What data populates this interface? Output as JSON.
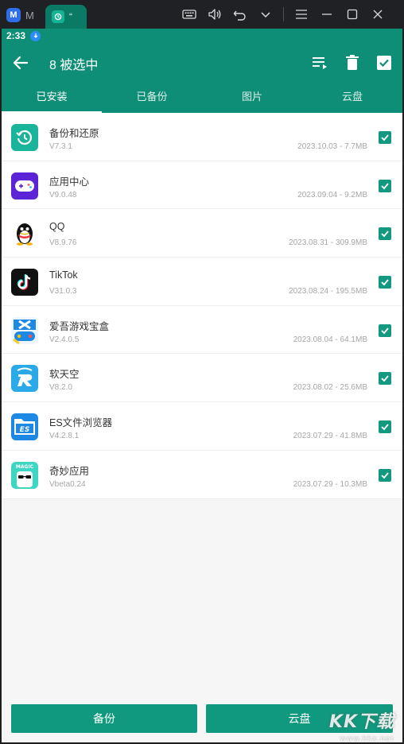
{
  "window": {
    "tab1_label": "M",
    "tab2_label": "“",
    "tools": [
      "keyboard-icon",
      "volume-icon",
      "undo-icon",
      "chevron-down-icon",
      "menu-icon",
      "minimize-icon",
      "maximize-icon",
      "close-icon"
    ]
  },
  "status": {
    "time": "2:33"
  },
  "appbar": {
    "title": "8 被选中"
  },
  "tabs": [
    {
      "label": "已安装",
      "active": true
    },
    {
      "label": "已备份",
      "active": false
    },
    {
      "label": "图片",
      "active": false
    },
    {
      "label": "云盘",
      "active": false
    }
  ],
  "apps": [
    {
      "name": "备份和还原",
      "version": "V7.3.1",
      "meta": "2023.10.03 - 7.7MB",
      "icon": "backup-restore-icon",
      "checked": true
    },
    {
      "name": "应用中心",
      "version": "V9.0.48",
      "meta": "2023.09.04 - 9.2MB",
      "icon": "game-controller-icon",
      "checked": true
    },
    {
      "name": "QQ",
      "version": "V8.9.76",
      "meta": "2023.08.31 - 309.9MB",
      "icon": "qq-penguin-icon",
      "checked": true
    },
    {
      "name": "TikTok",
      "version": "V31.0.3",
      "meta": "2023.08.24 - 195.5MB",
      "icon": "tiktok-icon",
      "checked": true
    },
    {
      "name": "爱吾游戏宝盒",
      "version": "V2.4.0.5",
      "meta": "2023.08.04 - 64.1MB",
      "icon": "aiwu-game-box-icon",
      "checked": true
    },
    {
      "name": "软天空",
      "version": "V8.2.0",
      "meta": "2023.08.02 - 25.6MB",
      "icon": "ruantiankong-icon",
      "checked": true
    },
    {
      "name": "ES文件浏览器",
      "version": "V4.2.8.1",
      "meta": "2023.07.29 - 41.8MB",
      "icon": "es-file-explorer-icon",
      "checked": true
    },
    {
      "name": "奇妙应用",
      "version": "Vbeta0.24",
      "meta": "2023.07.29 - 10.3MB",
      "icon": "magic-app-icon",
      "checked": true
    }
  ],
  "buttons": {
    "backup": "备份",
    "cloud": "云盘"
  },
  "watermark": {
    "main": "KK下载",
    "url": "www.kkx.net"
  },
  "colors": {
    "primary": "#0f8e77",
    "button": "#11997f",
    "checkbox": "#13997f"
  }
}
